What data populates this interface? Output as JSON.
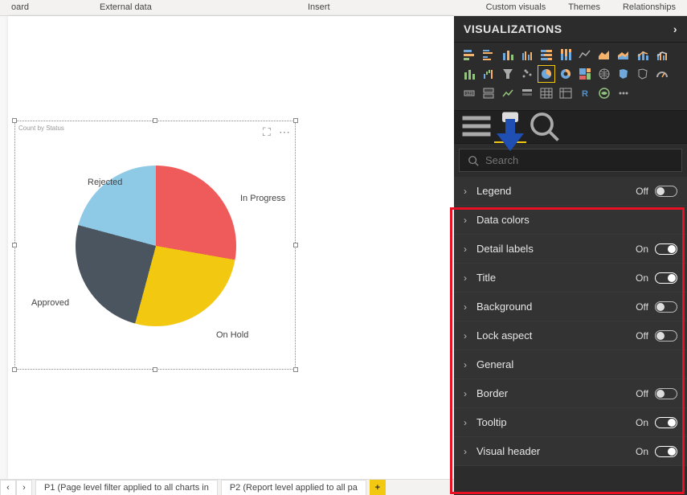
{
  "ribbon": {
    "tabs": [
      "oard",
      "External data",
      "Insert",
      "Custom visuals",
      "Themes",
      "Relationships"
    ]
  },
  "panel": {
    "title": "VISUALIZATIONS",
    "search_placeholder": "Search"
  },
  "format_items": [
    {
      "label": "Legend",
      "state": "Off"
    },
    {
      "label": "Data colors",
      "state": null
    },
    {
      "label": "Detail labels",
      "state": "On"
    },
    {
      "label": "Title",
      "state": "On"
    },
    {
      "label": "Background",
      "state": "Off"
    },
    {
      "label": "Lock aspect",
      "state": "Off"
    },
    {
      "label": "General",
      "state": null
    },
    {
      "label": "Border",
      "state": "Off"
    },
    {
      "label": "Tooltip",
      "state": "On"
    },
    {
      "label": "Visual header",
      "state": "On"
    }
  ],
  "chart_title": "Count by Status",
  "pages": {
    "p1": "P1 (Page level filter applied to all charts in",
    "p2": "P2 (Report level applied to all pa"
  },
  "chart_data": {
    "type": "pie",
    "title": "Count by Status",
    "series": [
      {
        "name": "In Progress",
        "value": 28,
        "color": "#ef5b5b"
      },
      {
        "name": "On Hold",
        "value": 26,
        "color": "#f2c811"
      },
      {
        "name": "Approved",
        "value": 25,
        "color": "#4a5560"
      },
      {
        "name": "Rejected",
        "value": 21,
        "color": "#8ecae6"
      }
    ],
    "labels": {
      "show": true
    },
    "legend": {
      "show": false
    }
  },
  "viz_icons": {
    "row1": [
      "stacked-bar",
      "clustered-bar",
      "stacked-column",
      "clustered-column",
      "hundred-stacked-bar",
      "hundred-stacked-column",
      "line",
      "area",
      "stacked-area",
      "line-stacked-column",
      "line-clustered-column"
    ],
    "row2": [
      "ribbon",
      "waterfall",
      "funnel",
      "scatter",
      "pie",
      "donut",
      "treemap",
      "map",
      "filled-map",
      "shape-map",
      "gauge"
    ],
    "row3": [
      "card",
      "multi-row-card",
      "kpi",
      "slicer",
      "table",
      "matrix",
      "r-visual",
      "python-visual",
      "more"
    ],
    "selected": "pie"
  },
  "glyphs": {
    "chevron_right": "›",
    "focus": "⛶",
    "more": "⋯"
  }
}
